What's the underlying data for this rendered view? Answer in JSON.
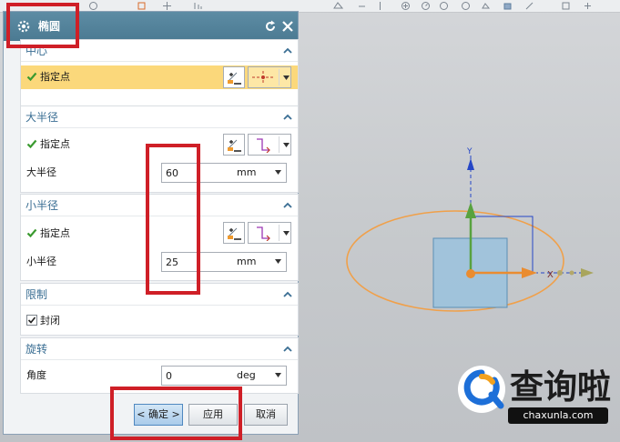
{
  "dialog": {
    "title": "椭圆",
    "sections": {
      "center": {
        "title": "中心",
        "point_label": "指定点"
      },
      "major": {
        "title": "大半径",
        "point_label": "指定点",
        "value_label": "大半径",
        "value": "60",
        "unit": "mm"
      },
      "minor": {
        "title": "小半径",
        "point_label": "指定点",
        "value_label": "小半径",
        "value": "25",
        "unit": "mm"
      },
      "limit": {
        "title": "限制",
        "closed_label": "封闭",
        "closed_checked": true
      },
      "rotation": {
        "title": "旋转",
        "angle_label": "角度",
        "angle_value": "0",
        "angle_unit": "deg"
      }
    },
    "buttons": {
      "ok": "< 确定 >",
      "apply": "应用",
      "cancel": "取消"
    }
  },
  "viewport": {
    "y_axis_label": "Y",
    "x_axis_label": "X",
    "ellipse_color": "#f0a04a",
    "square_color": "#9cc2dd",
    "axis_green": "#58a23f",
    "axis_orange": "#ea8c30",
    "axis_blue": "#2546c6"
  },
  "watermark": {
    "title": "查询啦",
    "subtitle": "chaxunla.com"
  },
  "colors": {
    "title_bar": "#4b7a92",
    "highlight_row": "#fbd87b",
    "section_title": "#3a6e93",
    "annotation_red": "#cf1f27"
  }
}
